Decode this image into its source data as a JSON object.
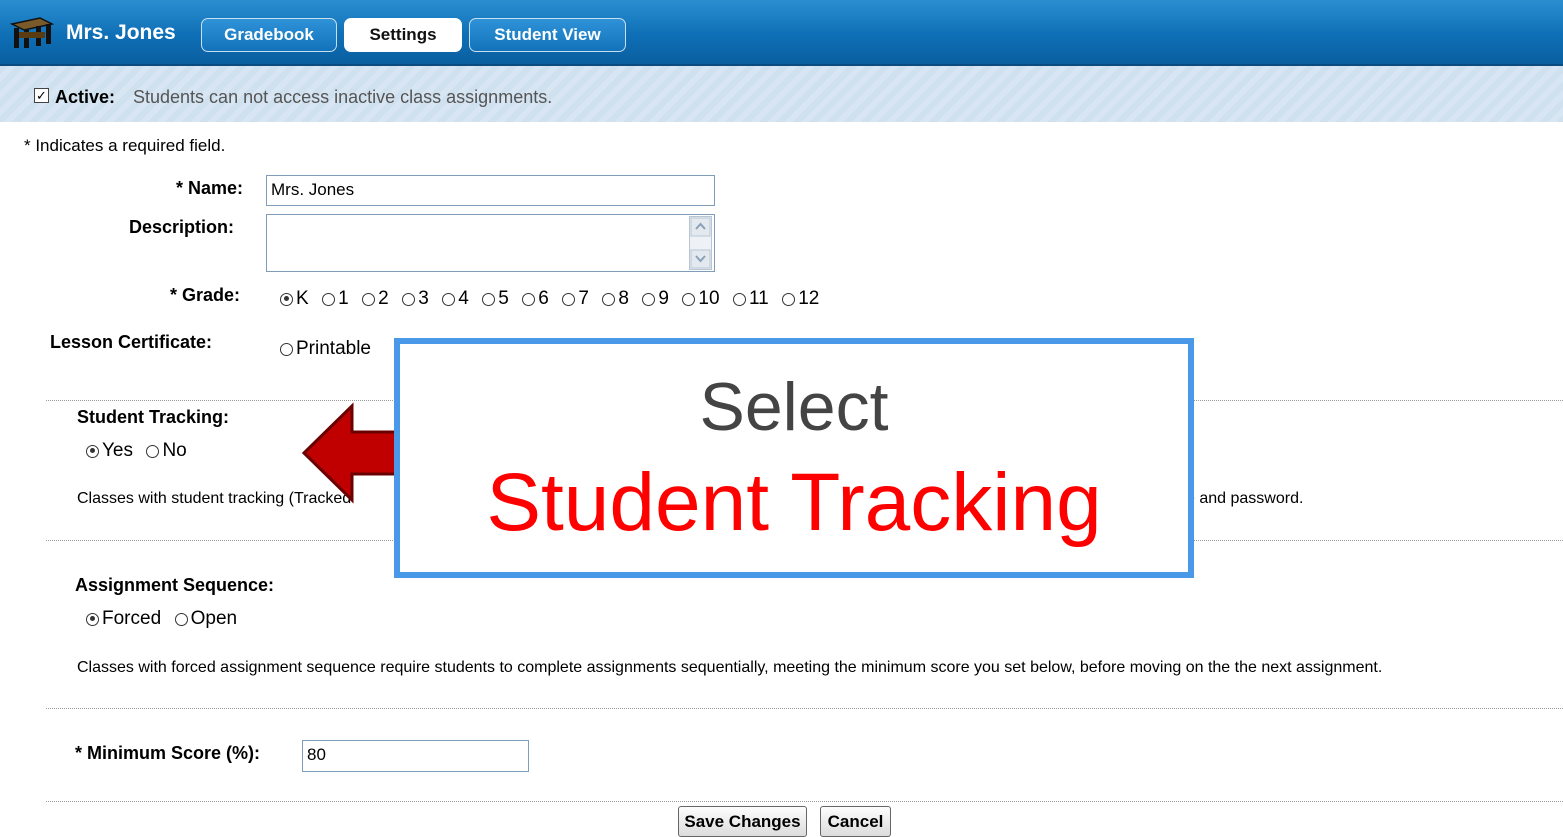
{
  "header": {
    "teacher_name": "Mrs. Jones",
    "tabs": [
      {
        "label": "Gradebook"
      },
      {
        "label": "Settings"
      },
      {
        "label": "Student View"
      }
    ]
  },
  "active_bar": {
    "checked": true,
    "label": "Active:",
    "note": "Students can not access inactive class assignments."
  },
  "form": {
    "required_note": "* Indicates a required field.",
    "name_label": "* Name:",
    "name_value": "Mrs. Jones",
    "description_label": "Description:",
    "description_value": "",
    "grade_label": "* Grade:",
    "grade_options": [
      "K",
      "1",
      "2",
      "3",
      "4",
      "5",
      "6",
      "7",
      "8",
      "9",
      "10",
      "11",
      "12"
    ],
    "grade_selected": "K",
    "certificate_label": "Lesson Certificate:",
    "certificate_option": "Printable",
    "tracking_label": "Student Tracking:",
    "tracking_yes": "Yes",
    "tracking_no": "No",
    "tracking_selected": "Yes",
    "tracking_note_start": "Classes with student tracking (Tracked",
    "tracking_note_end": "e and password.",
    "sequence_label": "Assignment Sequence:",
    "sequence_forced": "Forced",
    "sequence_open": "Open",
    "sequence_selected": "Forced",
    "sequence_note": "Classes with forced assignment sequence require students to complete assignments sequentially, meeting the minimum score you set below, before moving on the the next assignment.",
    "min_score_label": "* Minimum Score (%):",
    "min_score_value": "80",
    "save_label": "Save Changes",
    "cancel_label": "Cancel"
  },
  "callout": {
    "line1": "Select",
    "line2": "Student Tracking",
    "line2_color": "#ff0000",
    "border_color": "#4a98e8",
    "arrow_color": "#c00000"
  }
}
